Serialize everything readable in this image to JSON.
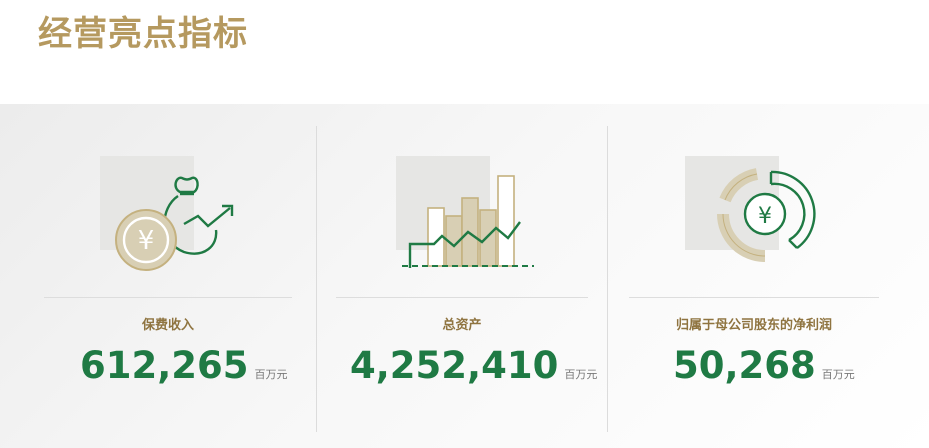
{
  "title": "经营亮点指标",
  "colors": {
    "gold": "#b5995f",
    "green": "#1f7a44",
    "beige": "#d8cfb4"
  },
  "metrics": [
    {
      "label": "保费收入",
      "value": "612,265",
      "unit": "百万元",
      "icon": "yuan-coin-money-bag-icon"
    },
    {
      "label": "总资产",
      "value": "4,252,410",
      "unit": "百万元",
      "icon": "bar-chart-trend-icon"
    },
    {
      "label": "归属于母公司股东的净利润",
      "value": "50,268",
      "unit": "百万元",
      "icon": "yuan-donut-chart-icon"
    }
  ]
}
